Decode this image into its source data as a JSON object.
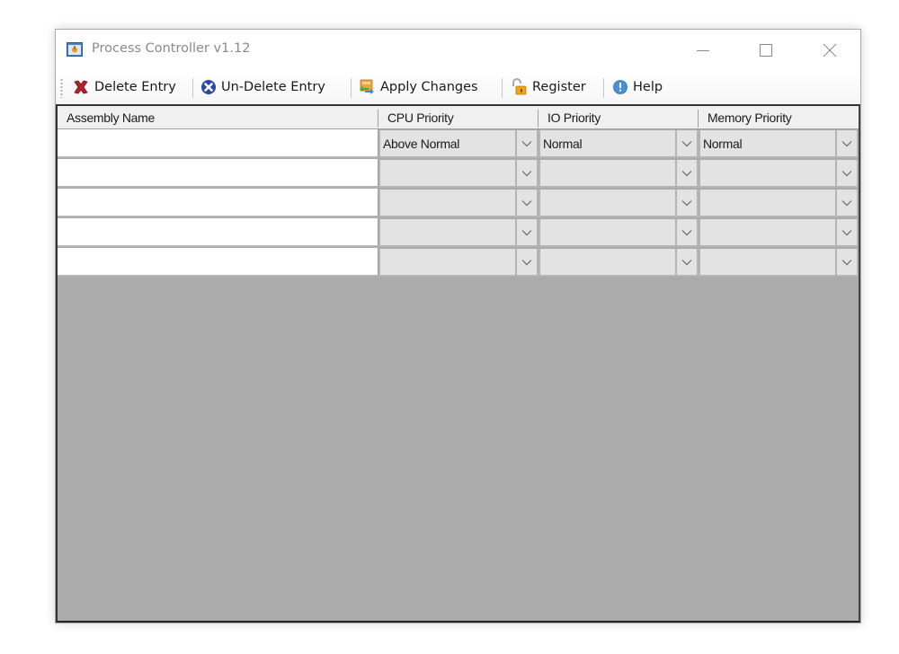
{
  "window": {
    "title": "Process Controller v1.12",
    "controls": [
      "minimize",
      "maximize",
      "close"
    ]
  },
  "toolbar": {
    "items": [
      {
        "label": "Delete Entry",
        "icon": "delete-x-icon"
      },
      {
        "label": "Un-Delete Entry",
        "icon": "undelete-circle-x-icon"
      },
      {
        "label": "Apply Changes",
        "icon": "apply-changes-icon"
      },
      {
        "label": "Register",
        "icon": "unlocked-padlock-icon"
      },
      {
        "label": "Help",
        "icon": "info-icon"
      }
    ]
  },
  "grid": {
    "columns": [
      "Assembly Name",
      "CPU Priority",
      "IO Priority",
      "Memory Priority"
    ],
    "rows": [
      {
        "assembly_name": "",
        "cpu_priority": "Above Normal",
        "io_priority": "Normal",
        "memory_priority": "Normal"
      },
      {
        "assembly_name": "",
        "cpu_priority": "",
        "io_priority": "",
        "memory_priority": ""
      },
      {
        "assembly_name": "",
        "cpu_priority": "",
        "io_priority": "",
        "memory_priority": ""
      },
      {
        "assembly_name": "",
        "cpu_priority": "",
        "io_priority": "",
        "memory_priority": ""
      },
      {
        "assembly_name": "",
        "cpu_priority": "",
        "io_priority": "",
        "memory_priority": ""
      }
    ]
  },
  "colors": {
    "grid_background": "#ababab",
    "combo_background": "#e3e3e3",
    "title_text": "#8a8a8a"
  }
}
